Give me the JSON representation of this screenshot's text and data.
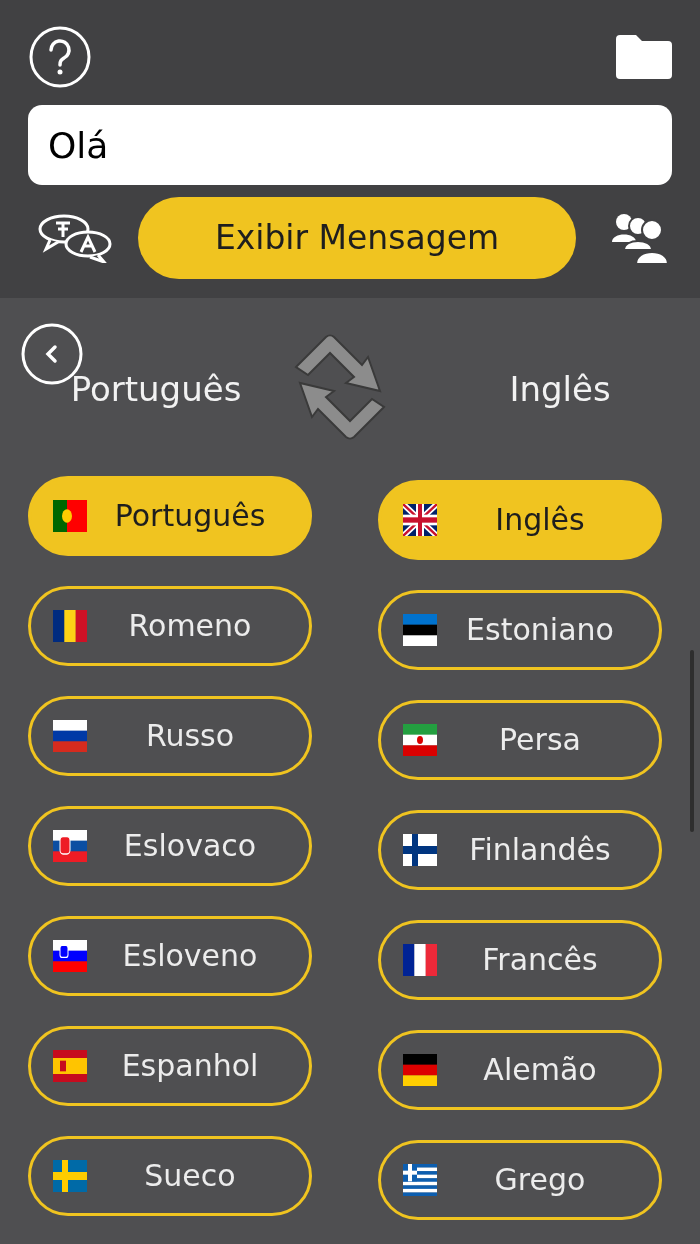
{
  "message_field": {
    "value": "Olá"
  },
  "show_button": {
    "label": "Exibir Mensagem"
  },
  "source_language": "Português",
  "target_language": "Inglês",
  "source_list": [
    {
      "label": "Português",
      "selected": true
    },
    {
      "label": "Romeno",
      "selected": false
    },
    {
      "label": "Russo",
      "selected": false
    },
    {
      "label": "Eslovaco",
      "selected": false
    },
    {
      "label": "Esloveno",
      "selected": false
    },
    {
      "label": "Espanhol",
      "selected": false
    },
    {
      "label": "Sueco",
      "selected": false
    }
  ],
  "target_list": [
    {
      "label": "Inglês",
      "selected": true
    },
    {
      "label": "Estoniano",
      "selected": false
    },
    {
      "label": "Persa",
      "selected": false
    },
    {
      "label": "Finlandês",
      "selected": false
    },
    {
      "label": "Francês",
      "selected": false
    },
    {
      "label": "Alemão",
      "selected": false
    },
    {
      "label": "Grego",
      "selected": false
    }
  ]
}
